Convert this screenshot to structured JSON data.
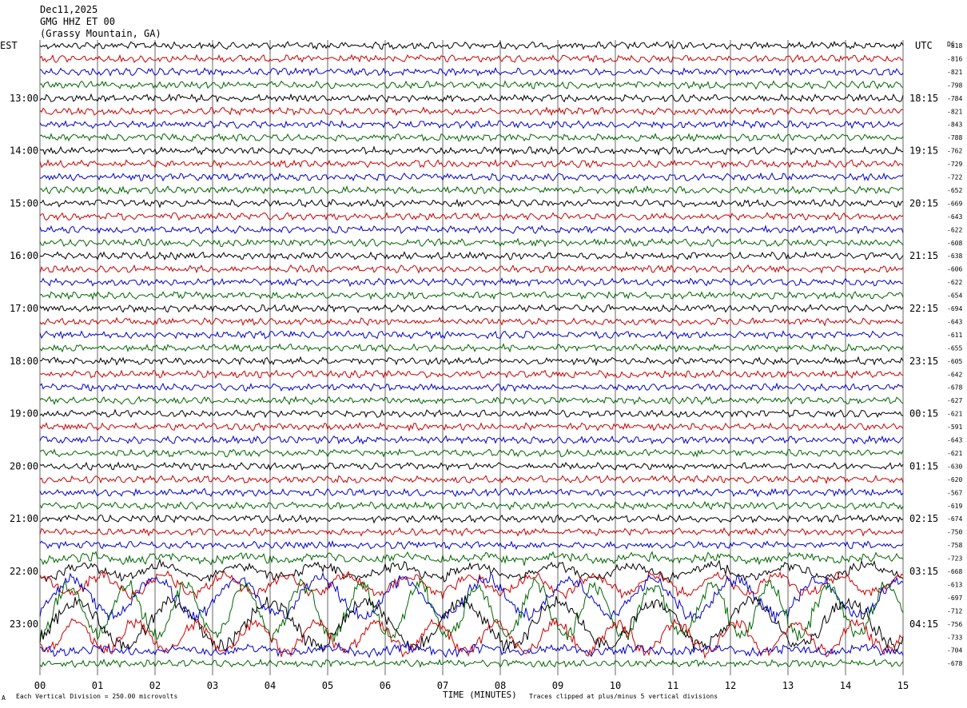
{
  "header": {
    "date": "Dec11,2025",
    "channel": "GMG HHZ ET 00",
    "station": "(Grassy Mountain, GA)"
  },
  "left_axis_label": "EST",
  "right_axis_label": "UTC",
  "dc_label": "DC",
  "footer": {
    "scale_text": "Each Vertical Division =  250.00 microvolts",
    "axis_title": "TIME (MINUTES)",
    "clip_text": "Traces clipped at plus/minus 5 vertical divisions",
    "corner_mark": "A"
  },
  "chart_data": {
    "type": "line",
    "title": "",
    "xlabel": "TIME (MINUTES)",
    "xlim": [
      0,
      15
    ],
    "x_ticks": [
      "00",
      "01",
      "02",
      "03",
      "04",
      "05",
      "06",
      "07",
      "08",
      "09",
      "10",
      "11",
      "12",
      "13",
      "14",
      "15"
    ],
    "trace_colors": [
      "#000000",
      "#cc0000",
      "#0000cc",
      "#006600"
    ],
    "trace_amplitudes": [
      1,
      1,
      1,
      1,
      1,
      1,
      1,
      1,
      1,
      1,
      1,
      1,
      1,
      1,
      1,
      1,
      1,
      1,
      1,
      1,
      1,
      1,
      1,
      1,
      1,
      1,
      1,
      1,
      1,
      1,
      1,
      1,
      1,
      1,
      1,
      1,
      1,
      1,
      1,
      1.3,
      1.8,
      2.2,
      3.5,
      4.5,
      4,
      3,
      1.3,
      1
    ],
    "est_hour_labels": [
      "13:00",
      "14:00",
      "15:00",
      "16:00",
      "17:00",
      "18:00",
      "19:00",
      "20:00",
      "21:00",
      "22:00",
      "23:00"
    ],
    "utc_hour_labels": [
      "18:15",
      "19:15",
      "20:15",
      "21:15",
      "22:15",
      "23:15",
      "00:15",
      "01:15",
      "02:15",
      "03:15",
      "04:15"
    ],
    "dc_offsets": [
      "-818",
      "-816",
      "-821",
      "-798",
      "-784",
      "-821",
      "-843",
      "-788",
      "-762",
      "-729",
      "-722",
      "-652",
      "-669",
      "-643",
      "-622",
      "-608",
      "-638",
      "-606",
      "-622",
      "-654",
      "-694",
      "-643",
      "-611",
      "-655",
      "-605",
      "-642",
      "-678",
      "-627",
      "-621",
      "-591",
      "-643",
      "-621",
      "-630",
      "-620",
      "-567",
      "-619",
      "-674",
      "-750",
      "-758",
      "-723",
      "-668",
      "-613",
      "-697",
      "-712",
      "-756",
      "-733",
      "-704",
      "-678"
    ]
  }
}
